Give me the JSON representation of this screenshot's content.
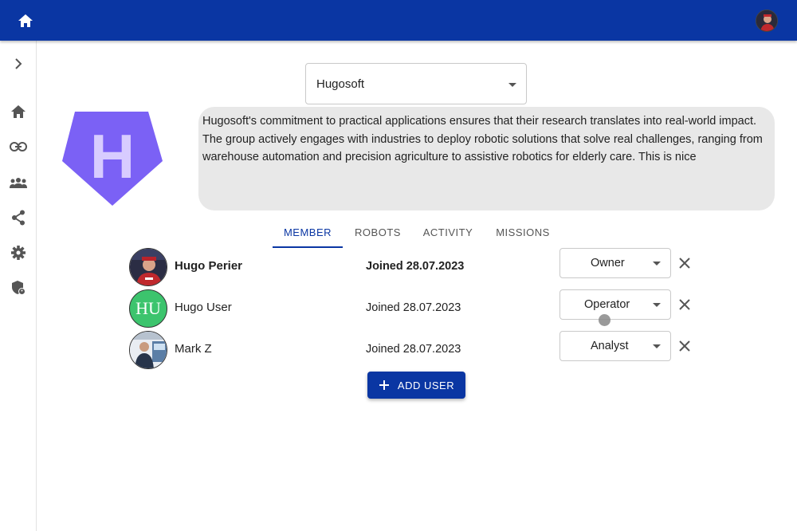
{
  "topbar": {
    "home_icon": "home-icon",
    "avatar_icon": "user-avatar"
  },
  "sidebar": {
    "items": [
      {
        "name": "expand",
        "icon": "chevron-right-icon"
      },
      {
        "name": "home",
        "icon": "home-icon"
      },
      {
        "name": "links",
        "icon": "link-icon"
      },
      {
        "name": "groups",
        "icon": "groups-icon"
      },
      {
        "name": "share",
        "icon": "share-icon"
      },
      {
        "name": "settings",
        "icon": "gear-icon"
      },
      {
        "name": "admin",
        "icon": "admin-shield-icon"
      }
    ]
  },
  "organization": {
    "selected": "Hugosoft",
    "logo_letter": "H",
    "logo_color": "#7b61f5",
    "description": "Hugosoft's commitment to practical applications ensures that their research translates into real-world impact. The group actively engages with industries to deploy robotic solutions that solve real challenges, ranging from warehouse automation and precision agriculture to assistive robotics for elderly care. This is nice"
  },
  "tabs": [
    {
      "label": "MEMBER",
      "active": true
    },
    {
      "label": "ROBOTS",
      "active": false
    },
    {
      "label": "ACTIVITY",
      "active": false
    },
    {
      "label": "MISSIONS",
      "active": false
    }
  ],
  "members": [
    {
      "name": "Hugo Perier",
      "joined": "Joined 28.07.2023",
      "role": "Owner",
      "current_user": true
    },
    {
      "name": "Hugo User",
      "joined": "Joined 28.07.2023",
      "role": "Operator",
      "initials": "HU",
      "avatar_color": "#3cc46d"
    },
    {
      "name": "Mark Z",
      "joined": "Joined 28.07.2023",
      "role": "Analyst"
    }
  ],
  "add_user": {
    "label": "ADD USER",
    "icon": "plus-icon"
  },
  "colors": {
    "primary": "#0a36a3",
    "description_bg": "#e8e8e8"
  }
}
